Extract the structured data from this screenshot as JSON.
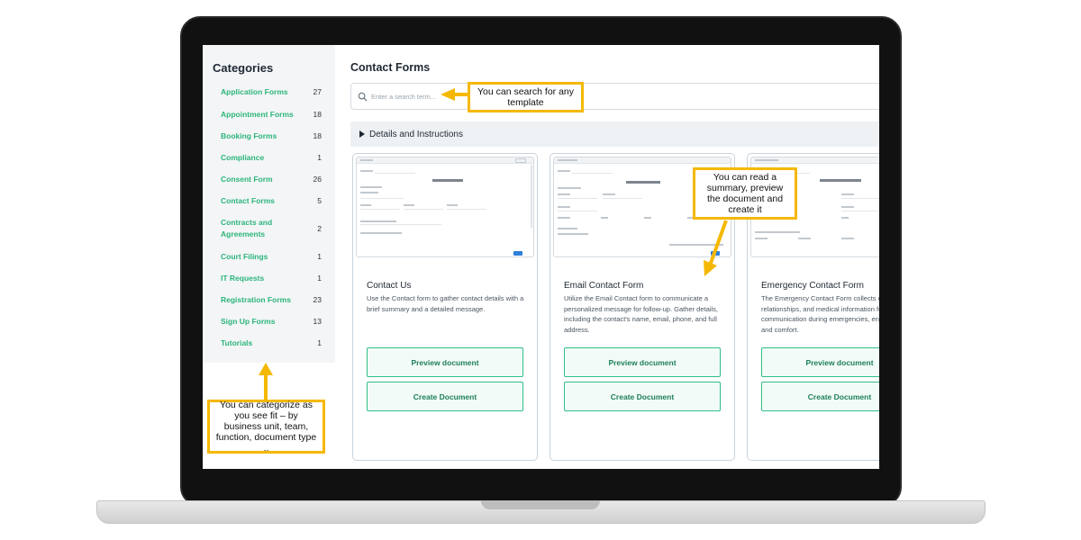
{
  "sidebar": {
    "title": "Categories",
    "items": [
      {
        "label": "Application Forms",
        "count": "27"
      },
      {
        "label": "Appointment Forms",
        "count": "18"
      },
      {
        "label": "Booking Forms",
        "count": "18"
      },
      {
        "label": "Compliance",
        "count": "1"
      },
      {
        "label": "Consent Form",
        "count": "26"
      },
      {
        "label": "Contact Forms",
        "count": "5"
      },
      {
        "label": "Contracts and Agreements",
        "count": "2"
      },
      {
        "label": "Court Filings",
        "count": "1"
      },
      {
        "label": "IT Requests",
        "count": "1"
      },
      {
        "label": "Registration Forms",
        "count": "23"
      },
      {
        "label": "Sign Up Forms",
        "count": "13"
      },
      {
        "label": "Tutorials",
        "count": "1"
      }
    ]
  },
  "main": {
    "title": "Contact Forms",
    "search": {
      "placeholder": "Enter a search term...",
      "value": ""
    },
    "details_label": "Details and Instructions"
  },
  "cards": [
    {
      "title": "Contact Us",
      "description": "Use the Contact form to gather contact details with a brief summary and a detailed message.",
      "preview_label": "Preview document",
      "create_label": "Create Document"
    },
    {
      "title": "Email Contact Form",
      "description": "Utilize the Email Contact form to communicate a personalized message for follow-up. Gather details, including the contact's name, email, phone, and full address.",
      "preview_label": "Preview document",
      "create_label": "Create Document"
    },
    {
      "title": "Emergency Contact Form",
      "description": "The Emergency Contact Form collects contact details, relationships, and medical information for swift communication during emergencies, ensuring safety and comfort.",
      "preview_label": "Preview document",
      "create_label": "Create Document"
    }
  ],
  "annotations": {
    "search": "You can search for any template",
    "card": "You can read a summary, preview the document and create it",
    "categories": "You can categorize as you see fit – by business unit, team, function, document type .."
  },
  "colors": {
    "accent_green": "#2db57a",
    "annotation_yellow": "#f5b800",
    "button_border": "#2fbf86"
  }
}
